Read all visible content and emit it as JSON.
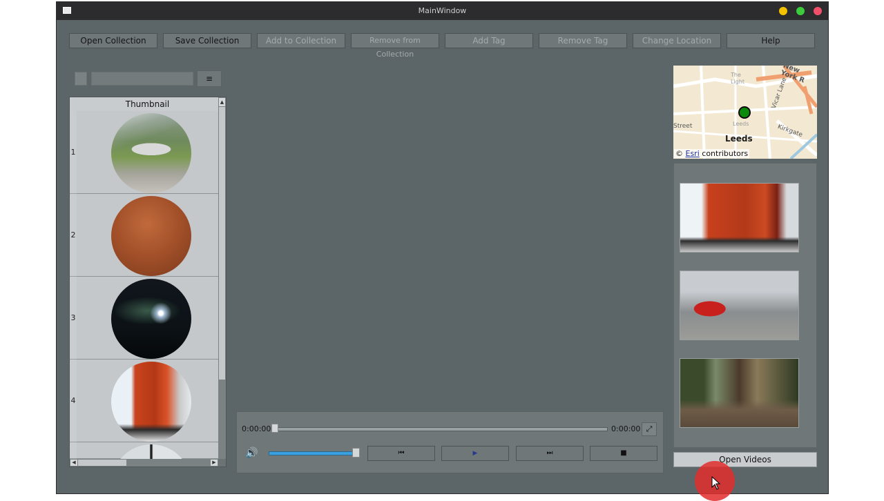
{
  "window": {
    "title": "MainWindow"
  },
  "toolbar": {
    "buttons": [
      {
        "label": "Open Collection",
        "enabled": true
      },
      {
        "label": "Save Collection",
        "enabled": true
      },
      {
        "label": "Add to Collection",
        "enabled": false
      },
      {
        "label": "Remove from Collection",
        "enabled": false
      },
      {
        "label": "Add Tag",
        "enabled": false
      },
      {
        "label": "Remove Tag",
        "enabled": false
      },
      {
        "label": "Change Location",
        "enabled": false
      },
      {
        "label": "Help",
        "enabled": true
      }
    ]
  },
  "search": {
    "menu_icon": "≡"
  },
  "table": {
    "header": "Thumbnail",
    "rows": [
      {
        "number": "1",
        "thumb": "mountain-road"
      },
      {
        "number": "2",
        "thumb": "orange-blur"
      },
      {
        "number": "3",
        "thumb": "night-scene"
      },
      {
        "number": "4",
        "thumb": "red-pagoda"
      }
    ]
  },
  "player": {
    "current_time": "0:00:00",
    "total_time": "0:00:00",
    "volume": 0.95,
    "controls": [
      "previous",
      "play",
      "next",
      "stop"
    ]
  },
  "map": {
    "city": "Leeds",
    "attribution_prefix": "©",
    "attribution_link": "Esri",
    "attribution_suffix": "contributors",
    "streets": [
      "New York R",
      "Vicar Lane",
      "Kirkgate",
      "Street",
      "The Light",
      "Leeds"
    ]
  },
  "videos": [
    {
      "thumb": "red-temple"
    },
    {
      "thumb": "street-truck"
    },
    {
      "thumb": "forest-playground"
    }
  ],
  "open_videos_label": "Open Videos"
}
